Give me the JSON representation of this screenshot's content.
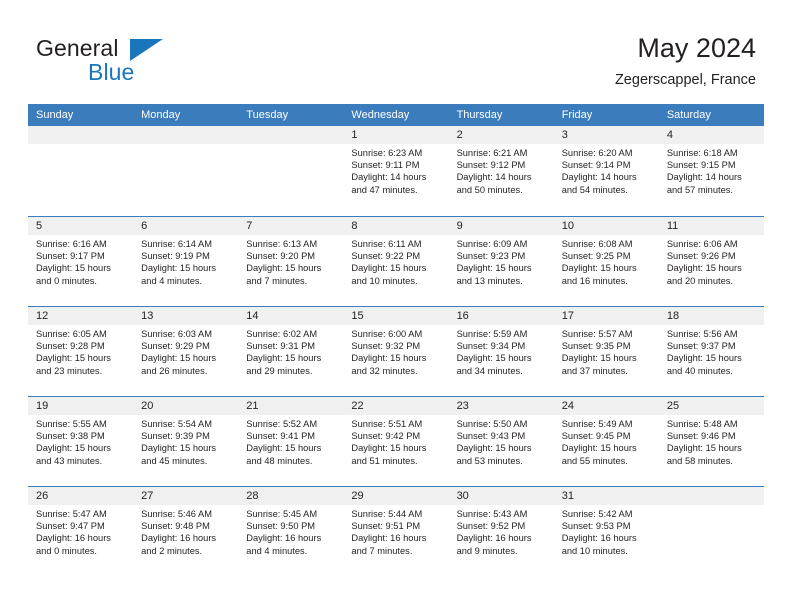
{
  "brand": {
    "line1": "General",
    "line2": "Blue",
    "triangle_color": "#1b75bb"
  },
  "header": {
    "title": "May 2024",
    "subtitle": "Zegerscappel, France"
  },
  "theme": {
    "header_row_bg": "#3b7cbd",
    "day_strip_bg": "#f0f0f0",
    "text_color": "#231f20",
    "row_divider": "#3b7cbd"
  },
  "weekday_headers": [
    "Sunday",
    "Monday",
    "Tuesday",
    "Wednesday",
    "Thursday",
    "Friday",
    "Saturday"
  ],
  "weeks": [
    [
      {
        "day": "",
        "empty": true
      },
      {
        "day": "",
        "empty": true
      },
      {
        "day": "",
        "empty": true
      },
      {
        "day": "1",
        "sunrise": "Sunrise: 6:23 AM",
        "sunset": "Sunset: 9:11 PM",
        "daylight1": "Daylight: 14 hours",
        "daylight2": "and 47 minutes."
      },
      {
        "day": "2",
        "sunrise": "Sunrise: 6:21 AM",
        "sunset": "Sunset: 9:12 PM",
        "daylight1": "Daylight: 14 hours",
        "daylight2": "and 50 minutes."
      },
      {
        "day": "3",
        "sunrise": "Sunrise: 6:20 AM",
        "sunset": "Sunset: 9:14 PM",
        "daylight1": "Daylight: 14 hours",
        "daylight2": "and 54 minutes."
      },
      {
        "day": "4",
        "sunrise": "Sunrise: 6:18 AM",
        "sunset": "Sunset: 9:15 PM",
        "daylight1": "Daylight: 14 hours",
        "daylight2": "and 57 minutes."
      }
    ],
    [
      {
        "day": "5",
        "sunrise": "Sunrise: 6:16 AM",
        "sunset": "Sunset: 9:17 PM",
        "daylight1": "Daylight: 15 hours",
        "daylight2": "and 0 minutes."
      },
      {
        "day": "6",
        "sunrise": "Sunrise: 6:14 AM",
        "sunset": "Sunset: 9:19 PM",
        "daylight1": "Daylight: 15 hours",
        "daylight2": "and 4 minutes."
      },
      {
        "day": "7",
        "sunrise": "Sunrise: 6:13 AM",
        "sunset": "Sunset: 9:20 PM",
        "daylight1": "Daylight: 15 hours",
        "daylight2": "and 7 minutes."
      },
      {
        "day": "8",
        "sunrise": "Sunrise: 6:11 AM",
        "sunset": "Sunset: 9:22 PM",
        "daylight1": "Daylight: 15 hours",
        "daylight2": "and 10 minutes."
      },
      {
        "day": "9",
        "sunrise": "Sunrise: 6:09 AM",
        "sunset": "Sunset: 9:23 PM",
        "daylight1": "Daylight: 15 hours",
        "daylight2": "and 13 minutes."
      },
      {
        "day": "10",
        "sunrise": "Sunrise: 6:08 AM",
        "sunset": "Sunset: 9:25 PM",
        "daylight1": "Daylight: 15 hours",
        "daylight2": "and 16 minutes."
      },
      {
        "day": "11",
        "sunrise": "Sunrise: 6:06 AM",
        "sunset": "Sunset: 9:26 PM",
        "daylight1": "Daylight: 15 hours",
        "daylight2": "and 20 minutes."
      }
    ],
    [
      {
        "day": "12",
        "sunrise": "Sunrise: 6:05 AM",
        "sunset": "Sunset: 9:28 PM",
        "daylight1": "Daylight: 15 hours",
        "daylight2": "and 23 minutes."
      },
      {
        "day": "13",
        "sunrise": "Sunrise: 6:03 AM",
        "sunset": "Sunset: 9:29 PM",
        "daylight1": "Daylight: 15 hours",
        "daylight2": "and 26 minutes."
      },
      {
        "day": "14",
        "sunrise": "Sunrise: 6:02 AM",
        "sunset": "Sunset: 9:31 PM",
        "daylight1": "Daylight: 15 hours",
        "daylight2": "and 29 minutes."
      },
      {
        "day": "15",
        "sunrise": "Sunrise: 6:00 AM",
        "sunset": "Sunset: 9:32 PM",
        "daylight1": "Daylight: 15 hours",
        "daylight2": "and 32 minutes."
      },
      {
        "day": "16",
        "sunrise": "Sunrise: 5:59 AM",
        "sunset": "Sunset: 9:34 PM",
        "daylight1": "Daylight: 15 hours",
        "daylight2": "and 34 minutes."
      },
      {
        "day": "17",
        "sunrise": "Sunrise: 5:57 AM",
        "sunset": "Sunset: 9:35 PM",
        "daylight1": "Daylight: 15 hours",
        "daylight2": "and 37 minutes."
      },
      {
        "day": "18",
        "sunrise": "Sunrise: 5:56 AM",
        "sunset": "Sunset: 9:37 PM",
        "daylight1": "Daylight: 15 hours",
        "daylight2": "and 40 minutes."
      }
    ],
    [
      {
        "day": "19",
        "sunrise": "Sunrise: 5:55 AM",
        "sunset": "Sunset: 9:38 PM",
        "daylight1": "Daylight: 15 hours",
        "daylight2": "and 43 minutes."
      },
      {
        "day": "20",
        "sunrise": "Sunrise: 5:54 AM",
        "sunset": "Sunset: 9:39 PM",
        "daylight1": "Daylight: 15 hours",
        "daylight2": "and 45 minutes."
      },
      {
        "day": "21",
        "sunrise": "Sunrise: 5:52 AM",
        "sunset": "Sunset: 9:41 PM",
        "daylight1": "Daylight: 15 hours",
        "daylight2": "and 48 minutes."
      },
      {
        "day": "22",
        "sunrise": "Sunrise: 5:51 AM",
        "sunset": "Sunset: 9:42 PM",
        "daylight1": "Daylight: 15 hours",
        "daylight2": "and 51 minutes."
      },
      {
        "day": "23",
        "sunrise": "Sunrise: 5:50 AM",
        "sunset": "Sunset: 9:43 PM",
        "daylight1": "Daylight: 15 hours",
        "daylight2": "and 53 minutes."
      },
      {
        "day": "24",
        "sunrise": "Sunrise: 5:49 AM",
        "sunset": "Sunset: 9:45 PM",
        "daylight1": "Daylight: 15 hours",
        "daylight2": "and 55 minutes."
      },
      {
        "day": "25",
        "sunrise": "Sunrise: 5:48 AM",
        "sunset": "Sunset: 9:46 PM",
        "daylight1": "Daylight: 15 hours",
        "daylight2": "and 58 minutes."
      }
    ],
    [
      {
        "day": "26",
        "sunrise": "Sunrise: 5:47 AM",
        "sunset": "Sunset: 9:47 PM",
        "daylight1": "Daylight: 16 hours",
        "daylight2": "and 0 minutes."
      },
      {
        "day": "27",
        "sunrise": "Sunrise: 5:46 AM",
        "sunset": "Sunset: 9:48 PM",
        "daylight1": "Daylight: 16 hours",
        "daylight2": "and 2 minutes."
      },
      {
        "day": "28",
        "sunrise": "Sunrise: 5:45 AM",
        "sunset": "Sunset: 9:50 PM",
        "daylight1": "Daylight: 16 hours",
        "daylight2": "and 4 minutes."
      },
      {
        "day": "29",
        "sunrise": "Sunrise: 5:44 AM",
        "sunset": "Sunset: 9:51 PM",
        "daylight1": "Daylight: 16 hours",
        "daylight2": "and 7 minutes."
      },
      {
        "day": "30",
        "sunrise": "Sunrise: 5:43 AM",
        "sunset": "Sunset: 9:52 PM",
        "daylight1": "Daylight: 16 hours",
        "daylight2": "and 9 minutes."
      },
      {
        "day": "31",
        "sunrise": "Sunrise: 5:42 AM",
        "sunset": "Sunset: 9:53 PM",
        "daylight1": "Daylight: 16 hours",
        "daylight2": "and 10 minutes."
      },
      {
        "day": "",
        "empty": true
      }
    ]
  ]
}
